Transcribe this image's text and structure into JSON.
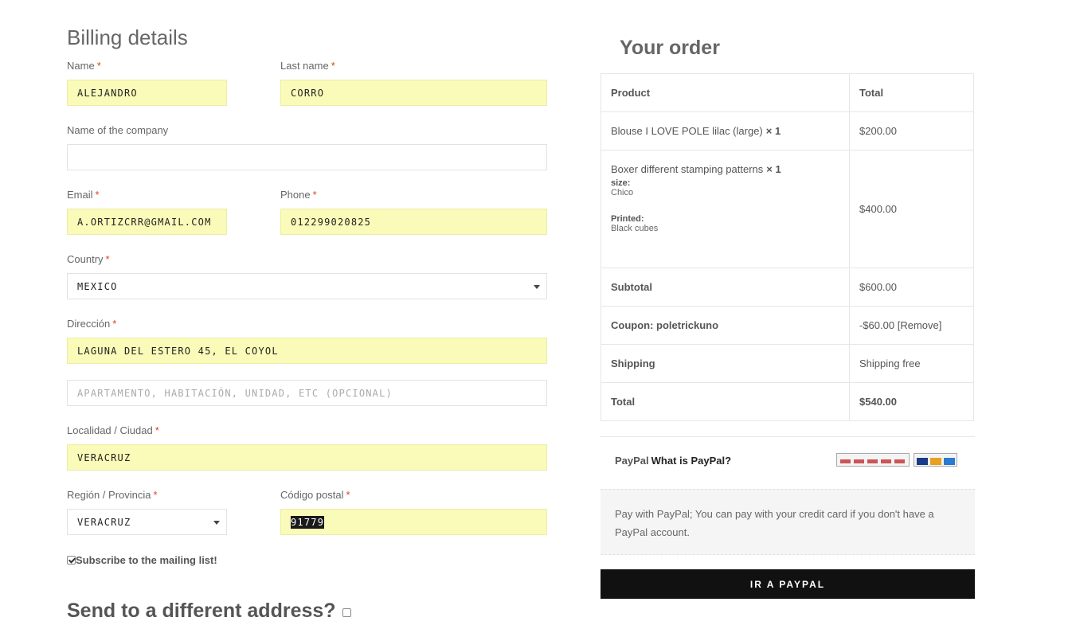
{
  "billing": {
    "title": "Billing details",
    "name": {
      "label": "Name",
      "value": "ALEJANDRO"
    },
    "last_name": {
      "label": "Last name",
      "value": "CORRO"
    },
    "company": {
      "label": "Name of the company",
      "value": ""
    },
    "email": {
      "label": "Email",
      "value": "A.ORTIZCRR@GMAIL.COM"
    },
    "phone": {
      "label": "Phone",
      "value": "012299020825"
    },
    "country": {
      "label": "Country",
      "value": "MEXICO"
    },
    "address": {
      "label": "Dirección",
      "value": "LAGUNA DEL ESTERO 45, EL COYOL"
    },
    "address2": {
      "placeholder": "APARTAMENTO, HABITACIÓN, UNIDAD, ETC (OPCIONAL)"
    },
    "city": {
      "label": "Localidad / Ciudad",
      "value": "VERACRUZ"
    },
    "region": {
      "label": "Región / Provincia",
      "value": "VERACRUZ"
    },
    "postal": {
      "label": "Código postal",
      "value": "91779"
    },
    "required_mark": "*",
    "subscribe_label": "Subscribe to the mailing list!",
    "subscribe_checked": true,
    "send_different": "Send to a different address?",
    "send_different_checked": false
  },
  "order": {
    "title": "Your order",
    "headers": {
      "product": "Product",
      "total": "Total"
    },
    "items": [
      {
        "name": "Blouse I LOVE POLE lilac (large)",
        "qty": "× 1",
        "price": "$200.00"
      },
      {
        "name": "Boxer different stamping patterns",
        "qty": "× 1",
        "meta": [
          {
            "key": "size:",
            "value": "Chico"
          },
          {
            "key": "Printed:",
            "value": "Black cubes"
          }
        ],
        "price": "$400.00"
      }
    ],
    "subtotal": {
      "label": "Subtotal",
      "value": "$600.00"
    },
    "coupon": {
      "label": "Coupon: poletrickuno",
      "value": "-$60.00",
      "remove": "[Remove]"
    },
    "shipping": {
      "label": "Shipping",
      "value": "Shipping free"
    },
    "total": {
      "label": "Total",
      "value": "$540.00"
    }
  },
  "payment": {
    "method": "PayPal",
    "what_is": "What is PayPal?",
    "description": "Pay with PayPal; You can pay with your credit card if you don't have a PayPal account.",
    "button": "IR A PAYPAL"
  },
  "colors": {
    "autofill": "#fafbb8",
    "required": "#e2401c",
    "button_bg": "#111111"
  }
}
